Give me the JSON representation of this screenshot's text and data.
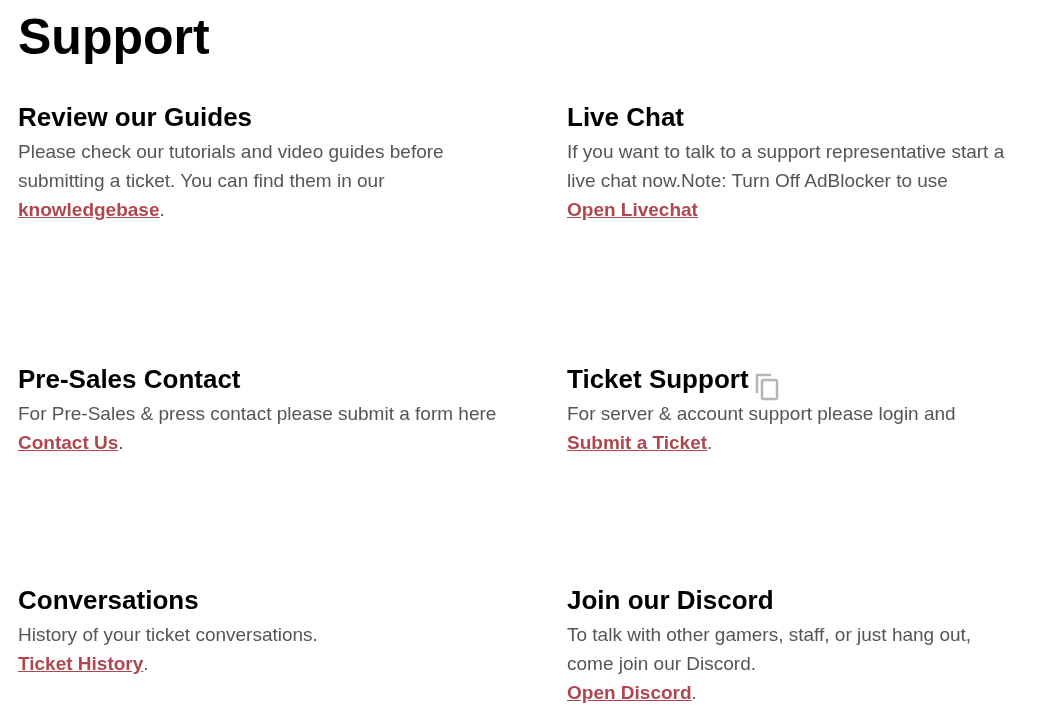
{
  "title": "Support",
  "cards": [
    {
      "title": "Review our Guides",
      "text": "Please check our tutorials and video guides before submitting a ticket. You can find them in our",
      "link": "knowledgebase",
      "after": ".",
      "copy_icon": false
    },
    {
      "title": "Live Chat",
      "text": "If you want to talk to a support representative start a live chat now.Note: Turn Off AdBlocker to use",
      "link": "Open Livechat",
      "copy_icon": false
    },
    {
      "title": "Pre-Sales Contact",
      "text": "For Pre-Sales & press contact please submit a form here",
      "link": "Contact Us",
      "after": ".",
      "copy_icon": false
    },
    {
      "title": "Ticket Support",
      "text": "For server & account support please login and",
      "link": "Submit a Ticket",
      "after": ".",
      "copy_icon": true
    },
    {
      "title": "Conversations",
      "text": "History of your ticket conversations.",
      "link": "Ticket History",
      "after": ".",
      "copy_icon": false
    },
    {
      "title": "Join our Discord",
      "text": "To talk with other gamers, staff, or just hang out, come join our Discord.",
      "link": "Open Discord",
      "after": ".",
      "copy_icon": false
    }
  ]
}
